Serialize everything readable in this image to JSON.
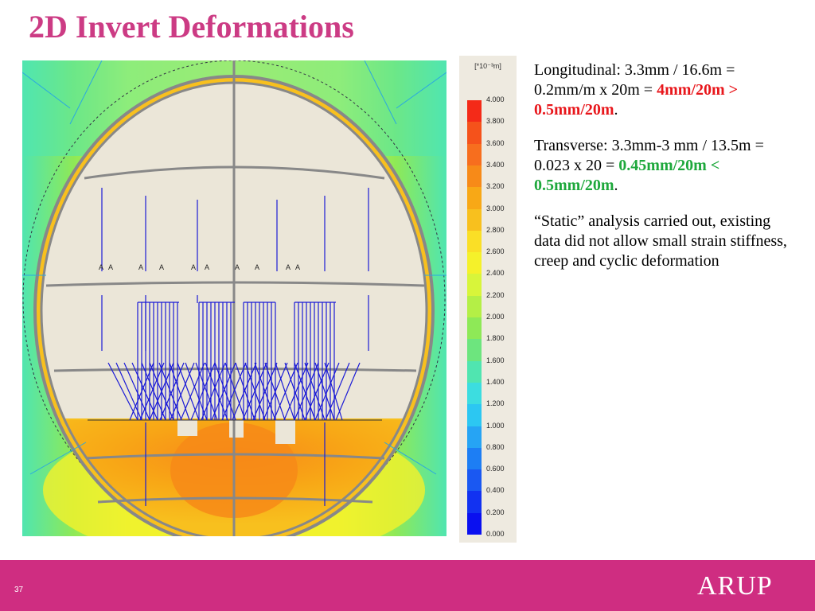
{
  "slide": {
    "title": "2D Invert Deformations",
    "page_number": "37",
    "logo_text": "ARUP"
  },
  "legend": {
    "unit": "[*10⁻³m]",
    "ticks": [
      "4.000",
      "3.800",
      "3.600",
      "3.400",
      "3.200",
      "3.000",
      "2.800",
      "2.600",
      "2.400",
      "2.200",
      "2.000",
      "1.800",
      "1.600",
      "1.400",
      "1.200",
      "1.000",
      "0.800",
      "0.600",
      "0.400",
      "0.200",
      "0.000"
    ],
    "colors": [
      "#f42a18",
      "#f5521b",
      "#f76e1e",
      "#f78a18",
      "#f8a816",
      "#f8c01e",
      "#fadf26",
      "#f5f12a",
      "#d8f53a",
      "#b4ef46",
      "#8ee957",
      "#6de57e",
      "#50e5b0",
      "#3cdde0",
      "#2cc7f2",
      "#26a4f4",
      "#1d7ef4",
      "#1a58f2",
      "#1232f1",
      "#0a10f0"
    ]
  },
  "notes": {
    "p1_a": "Longitudinal: 3.3mm / 16.6m = 0.2mm/m x 20m = ",
    "p1_b": "4mm/20m > 0.5mm/20m",
    "p1_c": ".",
    "p2_a": "Transverse: 3.3mm-3 mm / 13.5m = 0.023 x 20 = ",
    "p2_b": "0.45mm/20m < 0.5mm/20m",
    "p2_c": ".",
    "p3": "“Static” analysis carried out, existing data did not allow small strain stiffness, creep and cyclic deformation"
  },
  "model_labels": [
    "A",
    "A",
    "A",
    "A",
    "A",
    "A",
    "A",
    "A",
    "A",
    "A"
  ]
}
